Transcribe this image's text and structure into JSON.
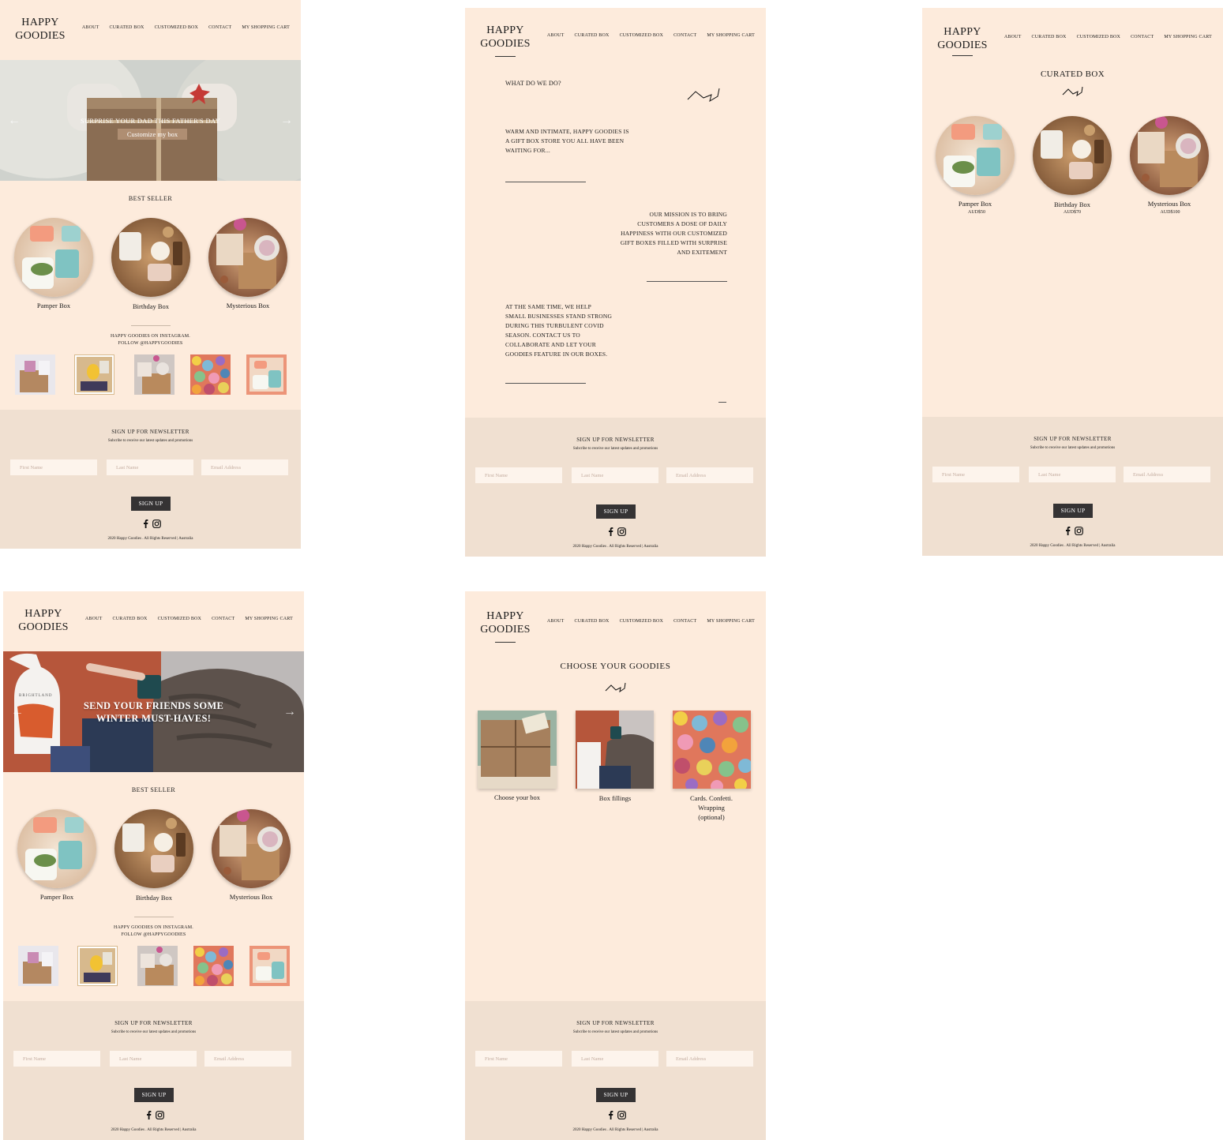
{
  "header": {
    "logo_line1": "HAPPY",
    "logo_line2": "GOODIES",
    "nav": [
      "ABOUT",
      "CURATED BOX",
      "CUSTOMIZED BOX",
      "CONTACT",
      "MY SHOPPING CART"
    ]
  },
  "home1": {
    "hero_title": "SURPRISE YOUR DAD THIS FATHER'S DAY",
    "hero_button": "Customize my box"
  },
  "home2": {
    "hero_title_line1": "SEND YOUR FRIENDS SOME",
    "hero_title_line2": "WINTER MUST-HAVES!",
    "bottle_label": "BRIGHTLAND"
  },
  "best_seller": {
    "title": "BEST SELLER",
    "items": [
      "Pamper Box",
      "Birthday Box",
      "Mysterious Box"
    ]
  },
  "instagram": {
    "line1": "HAPPY GOODIES ON INSTAGRAM.",
    "line2": "FOLLOW @HAPPYGOODIES"
  },
  "about": {
    "heading": "WHAT DO WE DO?",
    "p1_l1": "WARM AND INTIMATE, HAPPY GOODIES IS",
    "p1_l2": "A GIFT BOX STORE YOU ALL HAVE BEEN",
    "p1_l3": "WAITING FOR...",
    "p2_l1": "OUR MISSION IS TO BRING",
    "p2_l2": "CUSTOMERS A DOSE OF DAILY",
    "p2_l3": "HAPPINESS WITH OUR CUSTOMIZED",
    "p2_l4": "GIFT BOXES FILLED WITH SURPRISE",
    "p2_l5": "AND EXITEMENT",
    "p3_l1": "AT THE SAME TIME, WE HELP",
    "p3_l2": "SMALL BUSINESSES STAND STRONG",
    "p3_l3": "DURING THIS TURBULENT COVID",
    "p3_l4": "SEASON. CONTACT US TO",
    "p3_l5": "COLLABORATE AND LET YOUR",
    "p3_l6": "GOODIES FEATURE IN OUR BOXES."
  },
  "curated": {
    "title": "CURATED BOX",
    "items": [
      {
        "name": "Pamper Box",
        "price": "AUD$50"
      },
      {
        "name": "Birthday Box",
        "price": "AUD$70"
      },
      {
        "name": "Mysterious Box",
        "price": "AUD$100"
      }
    ]
  },
  "customize": {
    "title": "CHOOSE YOUR GOODIES",
    "step1": "Choose your box",
    "step2": "Box fillings",
    "step3_l1": "Cards. Confetti.",
    "step3_l2": "Wrapping",
    "step3_l3": "(optional)"
  },
  "newsletter": {
    "title": "SIGN UP FOR NEWSLETTER",
    "subtitle": "Subcribe to receive our latest updates and promotions",
    "first_name": "First Name",
    "last_name": "Last Name",
    "email": "Email Address",
    "button": "SIGN UP"
  },
  "footer": {
    "copyright": "2020 Happy Goodies . All Rights Reserved | Australia"
  },
  "icons": {
    "facebook": "facebook-icon",
    "instagram": "instagram-icon",
    "prev": "arrow-left-icon",
    "next": "arrow-right-icon"
  },
  "colors": {
    "page_bg": "#fdebdc",
    "footer_bg": "#f0e0d1",
    "button_bg": "#353334"
  }
}
